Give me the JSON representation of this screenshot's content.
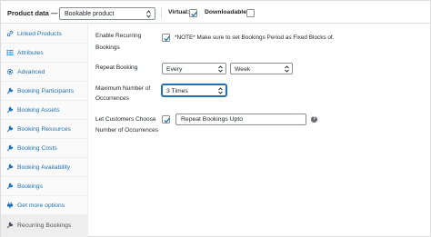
{
  "header": {
    "title": "Product data —",
    "product_type": "Bookable product",
    "virtual_label": "Virtual:",
    "virtual_checked": true,
    "downloadable_label": "Downloadable:",
    "downloadable_checked": false
  },
  "sidebar": {
    "items": [
      {
        "label": "Linked Products",
        "icon": "link-icon"
      },
      {
        "label": "Attributes",
        "icon": "list-icon"
      },
      {
        "label": "Advanced",
        "icon": "gear-icon"
      },
      {
        "label": "Booking Participants",
        "icon": "wrench-icon"
      },
      {
        "label": "Booking Assets",
        "icon": "wrench-icon"
      },
      {
        "label": "Booking Resources",
        "icon": "wrench-icon"
      },
      {
        "label": "Booking Costs",
        "icon": "wrench-icon"
      },
      {
        "label": "Booking Availability",
        "icon": "wrench-icon"
      },
      {
        "label": "Bookings",
        "icon": "wrench-icon"
      },
      {
        "label": "Get more options",
        "icon": "plugin-icon"
      },
      {
        "label": "Recurring Bookings",
        "icon": "wrench-icon",
        "active": true
      }
    ]
  },
  "main": {
    "enable_recurring": {
      "label_line1": "Enable Recurring",
      "label_line2": "Bookings",
      "checked": true,
      "note": "*NOTE* Make sure to set Bookings Period as Fixed Blocks of."
    },
    "repeat_booking": {
      "label": "Repeat Booking",
      "frequency": "Every",
      "period": "Week"
    },
    "max_occurrences": {
      "label_line1": "Maximum Number of",
      "label_line2": "Occurrences",
      "value": "3 Times"
    },
    "customer_choose": {
      "label_line1": "Let Customers Choose",
      "label_line2": "Number of Occurrences",
      "checked": true,
      "input_value": "Repeat Bookings Upto",
      "help_glyph": "?"
    }
  },
  "colors": {
    "accent": "#2271b1",
    "border": "#8c8f94",
    "sidebar_bg": "#fafafa",
    "active_bg": "#eeeeee"
  }
}
